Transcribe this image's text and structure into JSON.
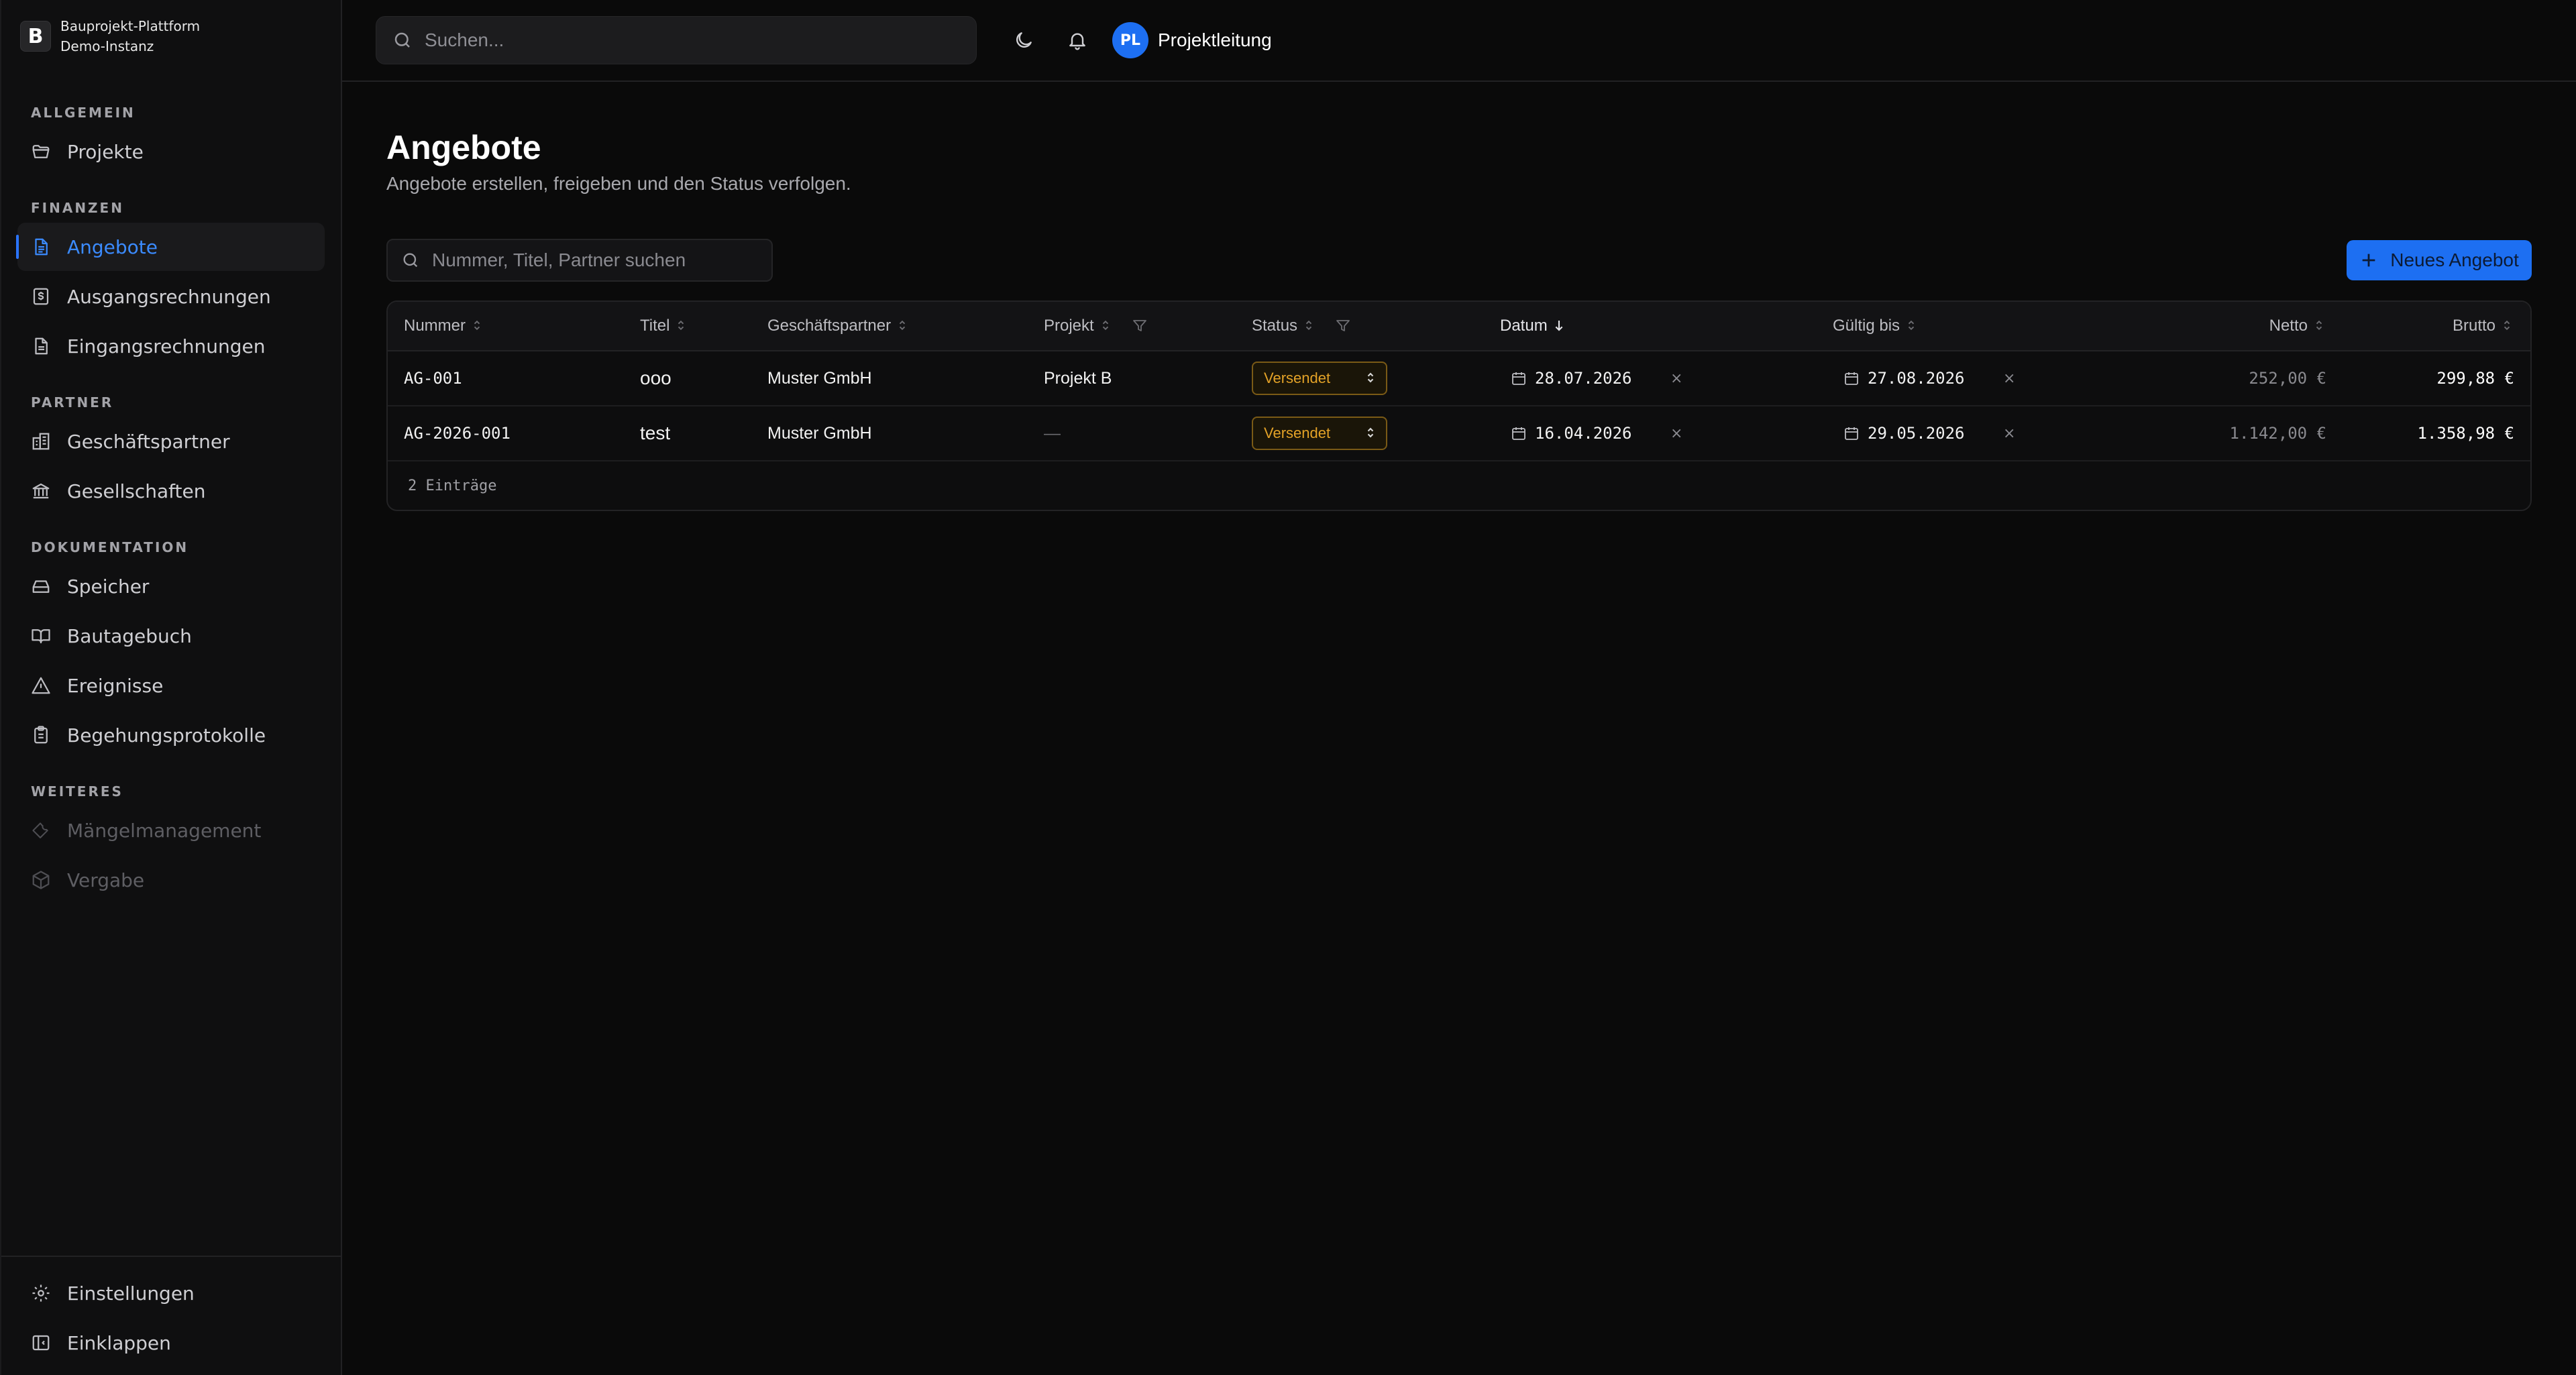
{
  "brand": {
    "logo": "B",
    "name": "Bauprojekt-Plattform",
    "subtitle": "Demo-Instanz"
  },
  "sidebar": {
    "sections": [
      {
        "title": "ALLGEMEIN",
        "items": [
          {
            "label": "Projekte",
            "icon": "folder-icon"
          }
        ]
      },
      {
        "title": "FINANZEN",
        "items": [
          {
            "label": "Angebote",
            "icon": "file-text-icon",
            "active": true
          },
          {
            "label": "Ausgangsrechnungen",
            "icon": "dollar-file-icon"
          },
          {
            "label": "Eingangsrechnungen",
            "icon": "file-icon"
          }
        ]
      },
      {
        "title": "PARTNER",
        "items": [
          {
            "label": "Geschäftspartner",
            "icon": "building-icon"
          },
          {
            "label": "Gesellschaften",
            "icon": "bank-icon"
          }
        ]
      },
      {
        "title": "DOKUMENTATION",
        "items": [
          {
            "label": "Speicher",
            "icon": "hard-drive-icon"
          },
          {
            "label": "Bautagebuch",
            "icon": "book-icon"
          },
          {
            "label": "Ereignisse",
            "icon": "warning-icon"
          },
          {
            "label": "Begehungsprotokolle",
            "icon": "clipboard-icon"
          }
        ]
      },
      {
        "title": "WEITERES",
        "items": [
          {
            "label": "Mängelmanagement",
            "icon": "wrench-icon",
            "disabled": true
          },
          {
            "label": "Vergabe",
            "icon": "package-icon",
            "disabled": true
          }
        ]
      }
    ],
    "bottom": [
      {
        "label": "Einstellungen",
        "icon": "settings-icon"
      },
      {
        "label": "Einklappen",
        "icon": "collapse-icon"
      }
    ]
  },
  "topbar": {
    "search_placeholder": "Suchen...",
    "avatar_initials": "PL",
    "user_name": "Projektleitung"
  },
  "page": {
    "title": "Angebote",
    "subtitle": "Angebote erstellen, freigeben und den Status verfolgen.",
    "search_placeholder": "Nummer, Titel, Partner suchen",
    "new_button": "Neues Angebot"
  },
  "table": {
    "columns": {
      "nummer": "Nummer",
      "titel": "Titel",
      "partner": "Geschäftspartner",
      "projekt": "Projekt",
      "status": "Status",
      "datum": "Datum",
      "gueltig": "Gültig bis",
      "netto": "Netto",
      "brutto": "Brutto"
    },
    "rows": [
      {
        "nummer": "AG-001",
        "titel": "ooo",
        "partner": "Muster GmbH",
        "projekt": "Projekt B",
        "status": "Versendet",
        "datum": "28.07.2026",
        "gueltig": "27.08.2026",
        "netto": "252,00 €",
        "brutto": "299,88 €"
      },
      {
        "nummer": "AG-2026-001",
        "titel": "test",
        "partner": "Muster GmbH",
        "projekt": "—",
        "status": "Versendet",
        "datum": "16.04.2026",
        "gueltig": "29.05.2026",
        "netto": "1.142,00 €",
        "brutto": "1.358,98 €"
      }
    ],
    "clear_symbol": "×",
    "count_label": "2 Einträge"
  },
  "colors": {
    "accent": "#1d6ff2",
    "status_amber": "#e3a227",
    "background": "#0a0a0a"
  }
}
